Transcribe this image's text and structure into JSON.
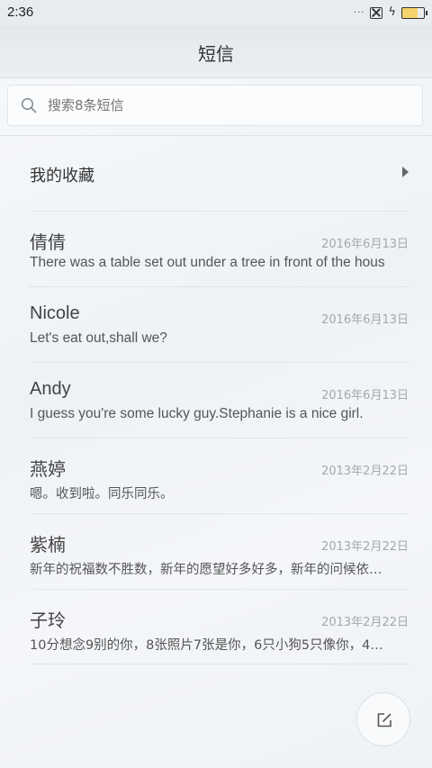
{
  "status_bar": {
    "time": "2:36",
    "icons": [
      "signal-dots-icon",
      "no-sim-icon",
      "charging-bolt-icon",
      "battery-icon"
    ]
  },
  "header": {
    "title": "短信"
  },
  "search": {
    "placeholder": "搜索8条短信"
  },
  "favorites": {
    "label": "我的收藏"
  },
  "conversations": [
    {
      "name": "倩倩",
      "date": "2016年6月13日",
      "preview": "There was a table set out under a tree in front of the hous"
    },
    {
      "name": "Nicole",
      "date": "2016年6月13日",
      "preview": "Let's eat out,shall we?"
    },
    {
      "name": "Andy",
      "date": "2016年6月13日",
      "preview": "I guess you're some lucky guy.Stephanie is a nice girl."
    },
    {
      "name": "燕婷",
      "date": "2013年2月22日",
      "preview": "嗯。收到啦。同乐同乐。"
    },
    {
      "name": "紫楠",
      "date": "2013年2月22日",
      "preview": "新年的祝福数不胜数，新年的愿望好多好多，新年的问候依…"
    },
    {
      "name": "子玲",
      "date": "2013年2月22日",
      "preview": "10分想念9别的你，8张照片7张是你，6只小狗5只像你，4…"
    }
  ],
  "colors": {
    "accent": "#333333",
    "muted": "#a4a8ad",
    "battery": "#f5d36a"
  }
}
